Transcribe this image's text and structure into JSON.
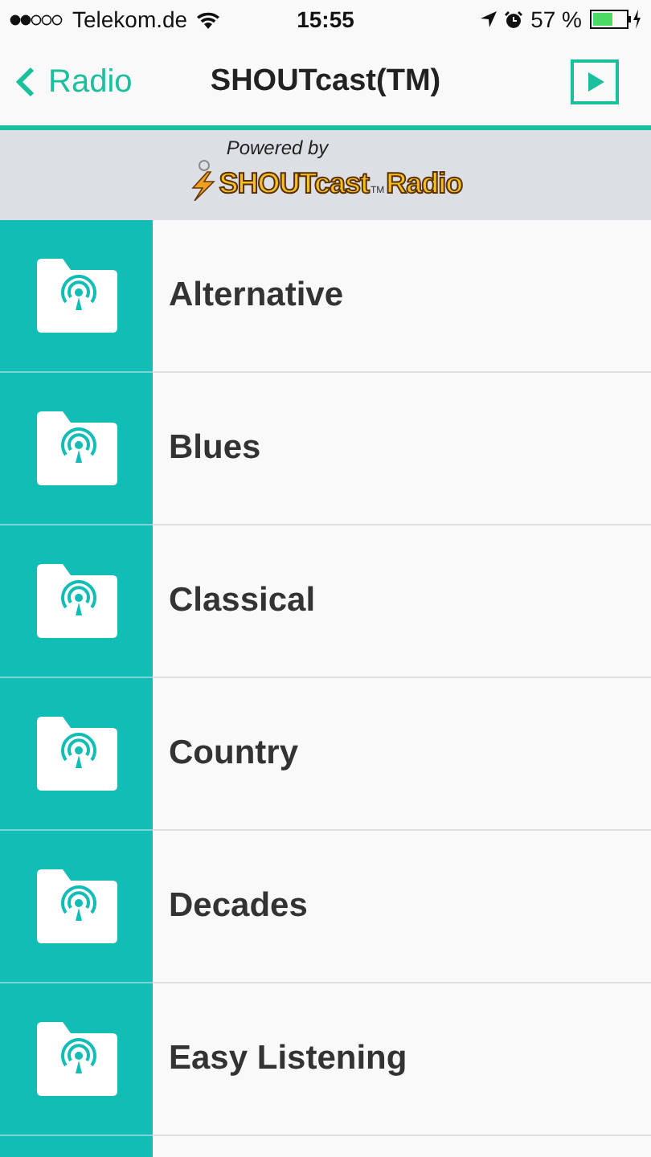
{
  "status_bar": {
    "carrier": "Telekom.de",
    "time": "15:55",
    "battery": "57 %"
  },
  "nav": {
    "back": "Radio",
    "title": "SHOUTcast(TM)"
  },
  "banner": {
    "powered_by": "Powered by",
    "logo_main": "SHOUTcast",
    "logo_tm": "TM",
    "logo_radio": "Radio"
  },
  "genres": [
    {
      "label": "Alternative"
    },
    {
      "label": "Blues"
    },
    {
      "label": "Classical"
    },
    {
      "label": "Country"
    },
    {
      "label": "Decades"
    },
    {
      "label": "Easy Listening"
    }
  ]
}
